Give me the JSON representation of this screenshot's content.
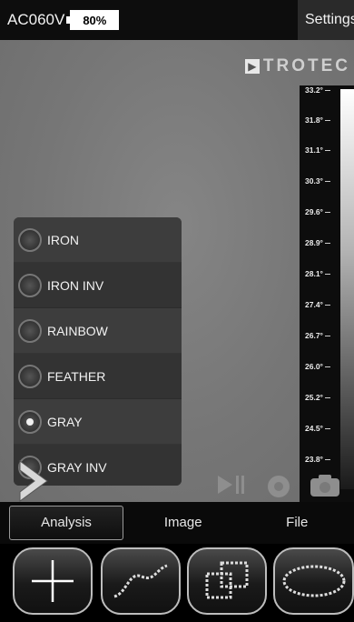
{
  "status": {
    "device": "AC060V",
    "battery": "80%",
    "settings_label": "Settings"
  },
  "logo_text": "TROTEC",
  "scale": {
    "ticks": [
      "33.2°",
      "31.8°",
      "31.1°",
      "30.3°",
      "29.6°",
      "28.9°",
      "28.1°",
      "27.4°",
      "26.7°",
      "26.0°",
      "25.2°",
      "24.5°",
      "23.8°"
    ]
  },
  "palette": {
    "items": [
      {
        "label": "IRON",
        "selected": false
      },
      {
        "label": "IRON INV",
        "selected": false
      },
      {
        "label": "RAINBOW",
        "selected": false
      },
      {
        "label": "FEATHER",
        "selected": false
      },
      {
        "label": "GRAY",
        "selected": true
      },
      {
        "label": "GRAY INV",
        "selected": false
      }
    ]
  },
  "tabs": [
    "Analysis",
    "Image",
    "File"
  ],
  "active_tab": "Analysis",
  "tools": [
    "crosshair-tool",
    "line-tool",
    "rectangle-tool",
    "ellipse-tool"
  ],
  "colors": {
    "viewport": "#7a7a7a",
    "panel": "#3a3a3a",
    "bar": "#0d0d0d"
  }
}
